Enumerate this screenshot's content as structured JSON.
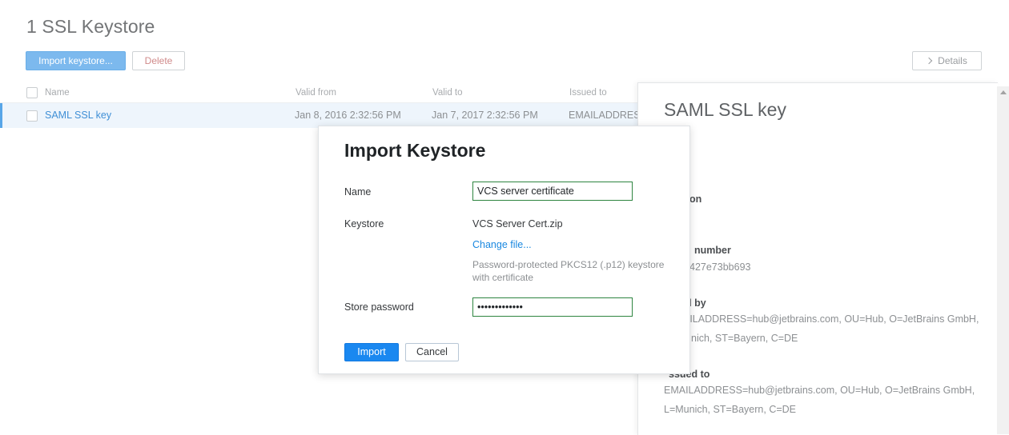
{
  "page": {
    "title": "1 SSL Keystore"
  },
  "toolbar": {
    "import_label": "Import keystore...",
    "delete_label": "Delete",
    "details_label": "Details"
  },
  "table": {
    "columns": [
      "Name",
      "Valid from",
      "Valid to",
      "Issued to"
    ],
    "rows": [
      {
        "name": "SAML SSL key",
        "valid_from": "Jan 8, 2016 2:32:56 PM",
        "valid_to": "Jan 7, 2017 2:32:56 PM",
        "issued_to": "EMAILADDRESS"
      }
    ]
  },
  "side_panel": {
    "title": "SAML SSL key",
    "partial_label_1": "on",
    "serial_label": "number",
    "serial_value": "427e73bb693",
    "issued_by_label": "d by",
    "issued_by_value": "AILADDRESS=hub@jetbrains.com, OU=Hub, O=JetBrains GmbH,",
    "issued_by_value_2": "nich, ST=Bayern, C=DE",
    "issued_to_label": "ssued to",
    "issued_to_value": "EMAILADDRESS=hub@jetbrains.com, OU=Hub, O=JetBrains GmbH,",
    "issued_to_value_2": "L=Munich, ST=Bayern, C=DE"
  },
  "dialog": {
    "title": "Import Keystore",
    "name_label": "Name",
    "name_value": "VCS server certificate",
    "keystore_label": "Keystore",
    "keystore_file": "VCS Server Cert.zip",
    "change_file_link": "Change file...",
    "keystore_hint": "Password-protected PKCS12 (.p12) keystore with certificate",
    "password_label": "Store password",
    "password_value": "•••••••••••••",
    "import_button": "Import",
    "cancel_button": "Cancel"
  },
  "colors": {
    "accent": "#1a88f0",
    "input_border": "#2e8540",
    "link": "#1a88e0"
  }
}
